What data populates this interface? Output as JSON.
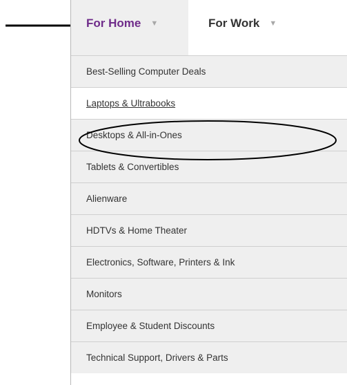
{
  "tabs": [
    {
      "label": "For Home",
      "active": true
    },
    {
      "label": "For Work",
      "active": false
    }
  ],
  "caret_glyph": "▼",
  "menu_items": [
    {
      "label": "Best-Selling Computer Deals"
    },
    {
      "label": "Laptops & Ultrabooks",
      "hovered": true
    },
    {
      "label": "Desktops & All-in-Ones",
      "circled": true
    },
    {
      "label": "Tablets & Convertibles"
    },
    {
      "label": "Alienware"
    },
    {
      "label": "HDTVs & Home Theater"
    },
    {
      "label": "Electronics, Software, Printers & Ink"
    },
    {
      "label": "Monitors"
    },
    {
      "label": "Employee & Student Discounts"
    },
    {
      "label": "Technical Support, Drivers & Parts"
    }
  ],
  "colors": {
    "active_tab_text": "#6f2c8a",
    "tab_text": "#333333",
    "menu_bg": "#efefef",
    "hover_bg": "#ffffff",
    "annotation": "#000000"
  },
  "annotations": {
    "arrow_icon": "right-arrow",
    "ellipse_target": "Desktops & All-in-Ones"
  }
}
